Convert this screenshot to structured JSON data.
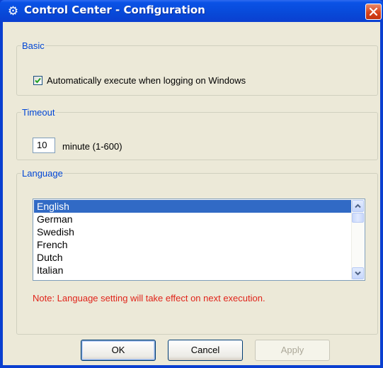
{
  "window": {
    "title": "Control Center - Configuration",
    "icon": "gear-icon",
    "close_icon": "close-icon"
  },
  "basic": {
    "legend": "Basic",
    "autorun_label": "Automatically execute when logging on Windows",
    "autorun_checked": true
  },
  "timeout": {
    "legend": "Timeout",
    "value": "10",
    "unit_label": "minute (1-600)"
  },
  "language": {
    "legend": "Language",
    "options": [
      "English",
      "German",
      "Swedish",
      "French",
      "Dutch",
      "Italian"
    ],
    "selected": "English",
    "note": "Note: Language setting will take effect on next execution."
  },
  "buttons": {
    "ok": "OK",
    "cancel": "Cancel",
    "apply": "Apply"
  },
  "colors": {
    "titlebar": "#0a52e6",
    "selection": "#316ac5",
    "note": "#e0241a",
    "legend": "#0046d5"
  }
}
